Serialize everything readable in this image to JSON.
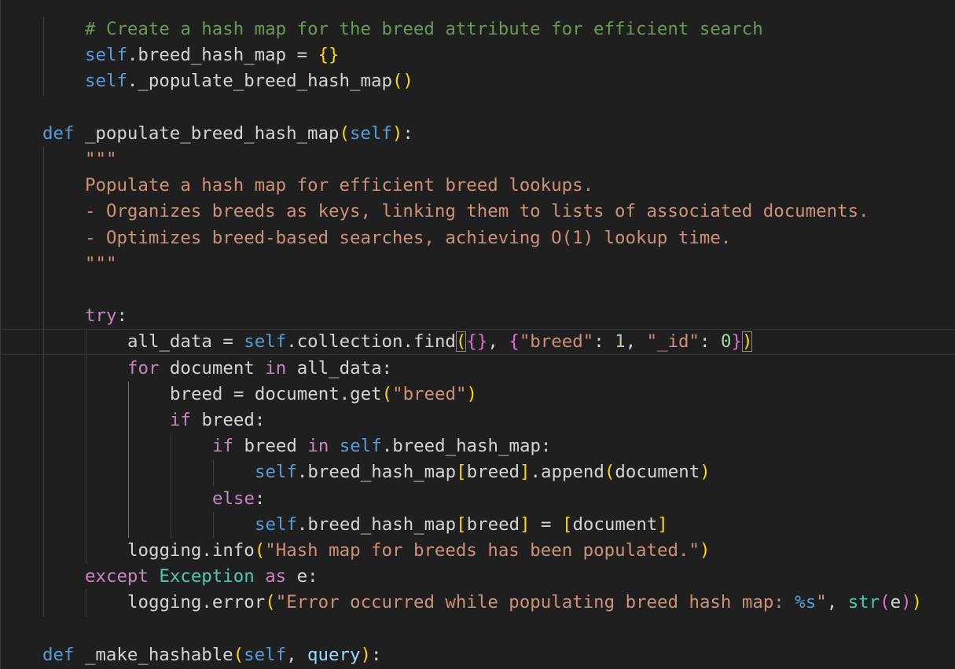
{
  "editor": {
    "theme_colors": {
      "background": "#1f1f1f",
      "keyword": "#569cd6",
      "control": "#c586c0",
      "string": "#ce9178",
      "comment": "#6a9955",
      "number": "#b5cea8",
      "class": "#4ec9b0",
      "bracket_gold": "#ffd700",
      "bracket_purple": "#da70d6",
      "bracket_blue": "#179fff"
    },
    "lines": [
      {
        "indent": 2,
        "tokens": [
          {
            "c": "cmt",
            "t": "# Create a hash map for the breed attribute for efficient search"
          }
        ]
      },
      {
        "indent": 2,
        "tokens": [
          {
            "c": "self",
            "t": "self"
          },
          {
            "c": "op",
            "t": ".breed_hash_map = "
          },
          {
            "c": "b1",
            "t": "{}"
          }
        ]
      },
      {
        "indent": 2,
        "tokens": [
          {
            "c": "self",
            "t": "self"
          },
          {
            "c": "op",
            "t": "._populate_breed_hash_map"
          },
          {
            "c": "b1",
            "t": "()"
          }
        ]
      },
      {
        "indent": 0,
        "tokens": []
      },
      {
        "indent": 1,
        "tokens": [
          {
            "c": "kw",
            "t": "def"
          },
          {
            "c": "op",
            "t": " "
          },
          {
            "c": "fnplain",
            "t": "_populate_breed_hash_map"
          },
          {
            "c": "b1",
            "t": "("
          },
          {
            "c": "self",
            "t": "self"
          },
          {
            "c": "b1",
            "t": ")"
          },
          {
            "c": "op",
            "t": ":"
          }
        ]
      },
      {
        "indent": 2,
        "tokens": [
          {
            "c": "str",
            "t": "\"\"\""
          }
        ]
      },
      {
        "indent": 2,
        "tokens": [
          {
            "c": "str",
            "t": "Populate a hash map for efficient breed lookups."
          }
        ]
      },
      {
        "indent": 2,
        "tokens": [
          {
            "c": "str",
            "t": "- Organizes breeds as keys, linking them to lists of associated documents."
          }
        ]
      },
      {
        "indent": 2,
        "tokens": [
          {
            "c": "str",
            "t": "- Optimizes breed-based searches, achieving O(1) lookup time."
          }
        ]
      },
      {
        "indent": 2,
        "tokens": [
          {
            "c": "str",
            "t": "\"\"\""
          }
        ]
      },
      {
        "indent": 0,
        "tokens": []
      },
      {
        "indent": 2,
        "tokens": [
          {
            "c": "ctl",
            "t": "try"
          },
          {
            "c": "op",
            "t": ":"
          }
        ]
      },
      {
        "indent": 3,
        "current": true,
        "tokens": [
          {
            "c": "op",
            "t": "all_data = "
          },
          {
            "c": "self",
            "t": "self"
          },
          {
            "c": "op",
            "t": ".collection.find"
          },
          {
            "c": "b1 bm",
            "t": "("
          },
          {
            "c": "b2",
            "t": "{}"
          },
          {
            "c": "op",
            "t": ", "
          },
          {
            "c": "b2",
            "t": "{"
          },
          {
            "c": "str",
            "t": "\"breed\""
          },
          {
            "c": "op",
            "t": ": "
          },
          {
            "c": "num",
            "t": "1"
          },
          {
            "c": "op",
            "t": ", "
          },
          {
            "c": "str",
            "t": "\"_id\""
          },
          {
            "c": "op",
            "t": ": "
          },
          {
            "c": "num",
            "t": "0"
          },
          {
            "c": "b2",
            "t": "}"
          },
          {
            "c": "b1 bm",
            "t": ")"
          }
        ]
      },
      {
        "indent": 3,
        "tokens": [
          {
            "c": "ctl",
            "t": "for"
          },
          {
            "c": "op",
            "t": " document "
          },
          {
            "c": "ctl",
            "t": "in"
          },
          {
            "c": "op",
            "t": " all_data:"
          }
        ]
      },
      {
        "indent": 4,
        "tokens": [
          {
            "c": "op",
            "t": "breed = document.get"
          },
          {
            "c": "b1",
            "t": "("
          },
          {
            "c": "str",
            "t": "\"breed\""
          },
          {
            "c": "b1",
            "t": ")"
          }
        ]
      },
      {
        "indent": 4,
        "tokens": [
          {
            "c": "ctl",
            "t": "if"
          },
          {
            "c": "op",
            "t": " breed:"
          }
        ]
      },
      {
        "indent": 5,
        "tokens": [
          {
            "c": "ctl",
            "t": "if"
          },
          {
            "c": "op",
            "t": " breed "
          },
          {
            "c": "ctl",
            "t": "in"
          },
          {
            "c": "op",
            "t": " "
          },
          {
            "c": "self",
            "t": "self"
          },
          {
            "c": "op",
            "t": ".breed_hash_map:"
          }
        ]
      },
      {
        "indent": 6,
        "tokens": [
          {
            "c": "self",
            "t": "self"
          },
          {
            "c": "op",
            "t": ".breed_hash_map"
          },
          {
            "c": "b1",
            "t": "["
          },
          {
            "c": "op",
            "t": "breed"
          },
          {
            "c": "b1",
            "t": "]"
          },
          {
            "c": "op",
            "t": ".append"
          },
          {
            "c": "b1",
            "t": "("
          },
          {
            "c": "op",
            "t": "document"
          },
          {
            "c": "b1",
            "t": ")"
          }
        ]
      },
      {
        "indent": 5,
        "tokens": [
          {
            "c": "ctl",
            "t": "else"
          },
          {
            "c": "op",
            "t": ":"
          }
        ]
      },
      {
        "indent": 6,
        "tokens": [
          {
            "c": "self",
            "t": "self"
          },
          {
            "c": "op",
            "t": ".breed_hash_map"
          },
          {
            "c": "b1",
            "t": "["
          },
          {
            "c": "op",
            "t": "breed"
          },
          {
            "c": "b1",
            "t": "]"
          },
          {
            "c": "op",
            "t": " = "
          },
          {
            "c": "b1",
            "t": "["
          },
          {
            "c": "op",
            "t": "document"
          },
          {
            "c": "b1",
            "t": "]"
          }
        ]
      },
      {
        "indent": 3,
        "tokens": [
          {
            "c": "op",
            "t": "logging.info"
          },
          {
            "c": "b1",
            "t": "("
          },
          {
            "c": "str",
            "t": "\"Hash map for breeds has been populated.\""
          },
          {
            "c": "b1",
            "t": ")"
          }
        ]
      },
      {
        "indent": 2,
        "tokens": [
          {
            "c": "ctl",
            "t": "except"
          },
          {
            "c": "op",
            "t": " "
          },
          {
            "c": "cls",
            "t": "Exception"
          },
          {
            "c": "op",
            "t": " "
          },
          {
            "c": "ctl",
            "t": "as"
          },
          {
            "c": "op",
            "t": " e:"
          }
        ]
      },
      {
        "indent": 3,
        "tokens": [
          {
            "c": "op",
            "t": "logging.error"
          },
          {
            "c": "b1",
            "t": "("
          },
          {
            "c": "str",
            "t": "\"Error occurred while populating breed hash map: "
          },
          {
            "c": "esc",
            "t": "%s"
          },
          {
            "c": "str",
            "t": "\""
          },
          {
            "c": "op",
            "t": ", "
          },
          {
            "c": "cls",
            "t": "str"
          },
          {
            "c": "b2",
            "t": "("
          },
          {
            "c": "op",
            "t": "e"
          },
          {
            "c": "b2",
            "t": ")"
          },
          {
            "c": "b1",
            "t": ")"
          }
        ]
      },
      {
        "indent": 0,
        "tokens": []
      },
      {
        "indent": 1,
        "tokens": [
          {
            "c": "kw",
            "t": "def"
          },
          {
            "c": "op",
            "t": " "
          },
          {
            "c": "fnplain",
            "t": "_make_hashable"
          },
          {
            "c": "b1",
            "t": "("
          },
          {
            "c": "self",
            "t": "self"
          },
          {
            "c": "op",
            "t": ", "
          },
          {
            "c": "param",
            "t": "query"
          },
          {
            "c": "b1",
            "t": ")"
          },
          {
            "c": "op",
            "t": ":"
          }
        ]
      }
    ]
  }
}
